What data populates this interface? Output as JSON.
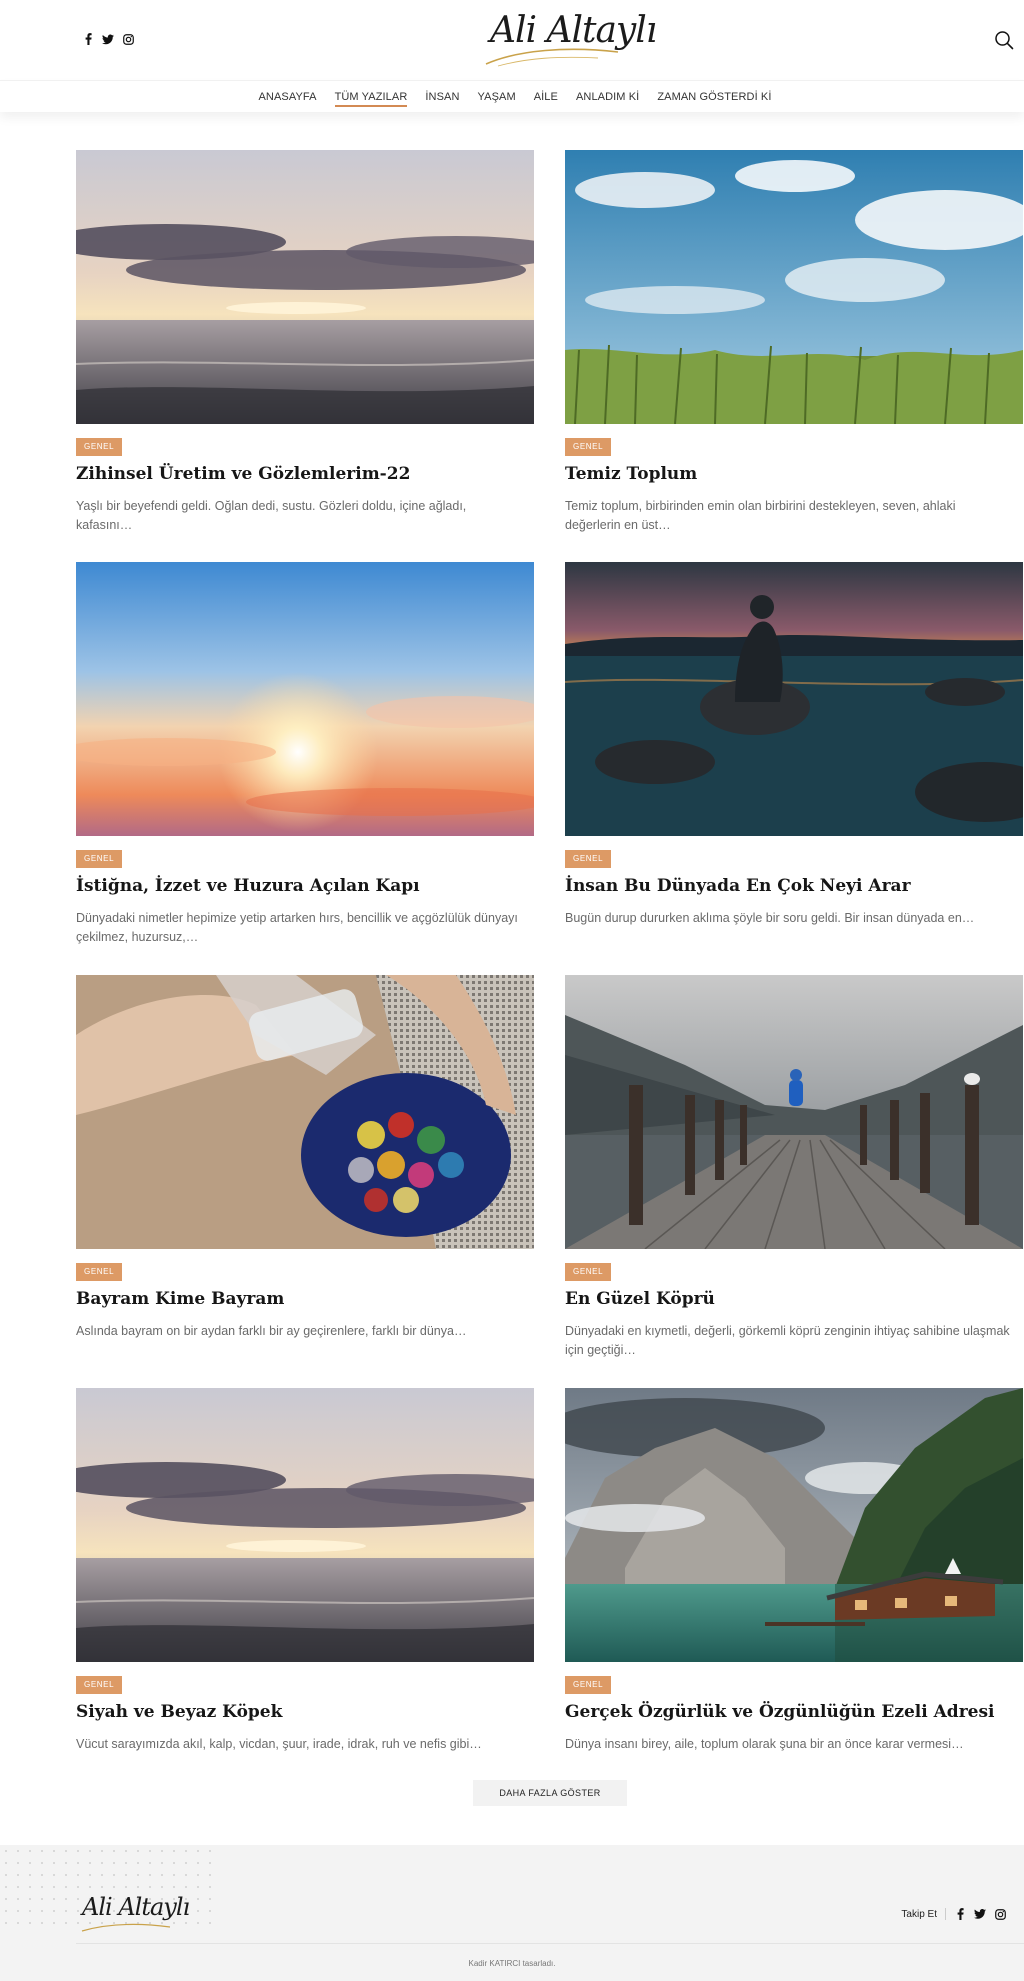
{
  "header": {
    "logo_text": "Ali Altaylı",
    "social": [
      "facebook-icon",
      "twitter-icon",
      "instagram-icon"
    ]
  },
  "nav": [
    {
      "label": "ANASAYFA",
      "active": false
    },
    {
      "label": "TÜM YAZILAR",
      "active": true
    },
    {
      "label": "İNSAN",
      "active": false
    },
    {
      "label": "YAŞAM",
      "active": false
    },
    {
      "label": "AİLE",
      "active": false
    },
    {
      "label": "ANLADIM Kİ",
      "active": false
    },
    {
      "label": "ZAMAN GÖSTERDİ Kİ",
      "active": false
    }
  ],
  "posts": [
    {
      "category": "GENEL",
      "title": "Zihinsel Üretim ve Gözlemlerim-22",
      "excerpt": "Yaşlı bir beyefendi geldi. Oğlan dedi, sustu. Gözleri doldu, içine ağladı, kafasını…",
      "image": "sea-sunset"
    },
    {
      "category": "GENEL",
      "title": "Temiz Toplum",
      "excerpt": "Temiz toplum, birbirinden emin olan birbirini destekleyen, seven, ahlaki değerlerin en üst…",
      "image": "sky-grass"
    },
    {
      "category": "GENEL",
      "title": "İstiğna, İzzet ve Huzura Açılan Kapı",
      "excerpt": "Dünyadaki nimetler hepimize yetip artarken hırs, bencillik ve açgözlülük dünyayı çekilmez, huzursuz,…",
      "image": "sky-sun"
    },
    {
      "category": "GENEL",
      "title": "İnsan Bu Dünyada En Çok Neyi Arar",
      "excerpt": "Bugün durup dururken aklıma şöyle bir soru geldi. Bir insan dünyada en…",
      "image": "man-rock-sunset"
    },
    {
      "category": "GENEL",
      "title": "Bayram Kime Bayram",
      "excerpt": "Aslında bayram on bir aydan farklı bir ay geçirenlere, farklı bir dünya…",
      "image": "candy-bowl"
    },
    {
      "category": "GENEL",
      "title": "En Güzel Köprü",
      "excerpt": "Dünyadaki en kıymetli, değerli, görkemli köprü zenginin ihtiyaç sahibine ulaşmak için geçtiği…",
      "image": "pier-lake"
    },
    {
      "category": "GENEL",
      "title": "Siyah ve Beyaz Köpek",
      "excerpt": "Vücut sarayımızda akıl, kalp, vicdan, şuur, irade, idrak, ruh ve nefis gibi…",
      "image": "sea-sunset"
    },
    {
      "category": "GENEL",
      "title": "Gerçek Özgürlük ve Özgünlüğün Ezeli Adresi",
      "excerpt": "Dünya insanı birey, aile, toplum olarak şuna bir an önce karar vermesi…",
      "image": "mountain-lake"
    }
  ],
  "load_more_label": "DAHA FAZLA GÖSTER",
  "footer": {
    "logo_text": "Ali Altaylı",
    "follow_label": "Takip Et",
    "credit": "Kadir KATIRCI tasarladı."
  },
  "colors": {
    "accent": "#dd9a65",
    "nav_underline": "#d38a53"
  }
}
